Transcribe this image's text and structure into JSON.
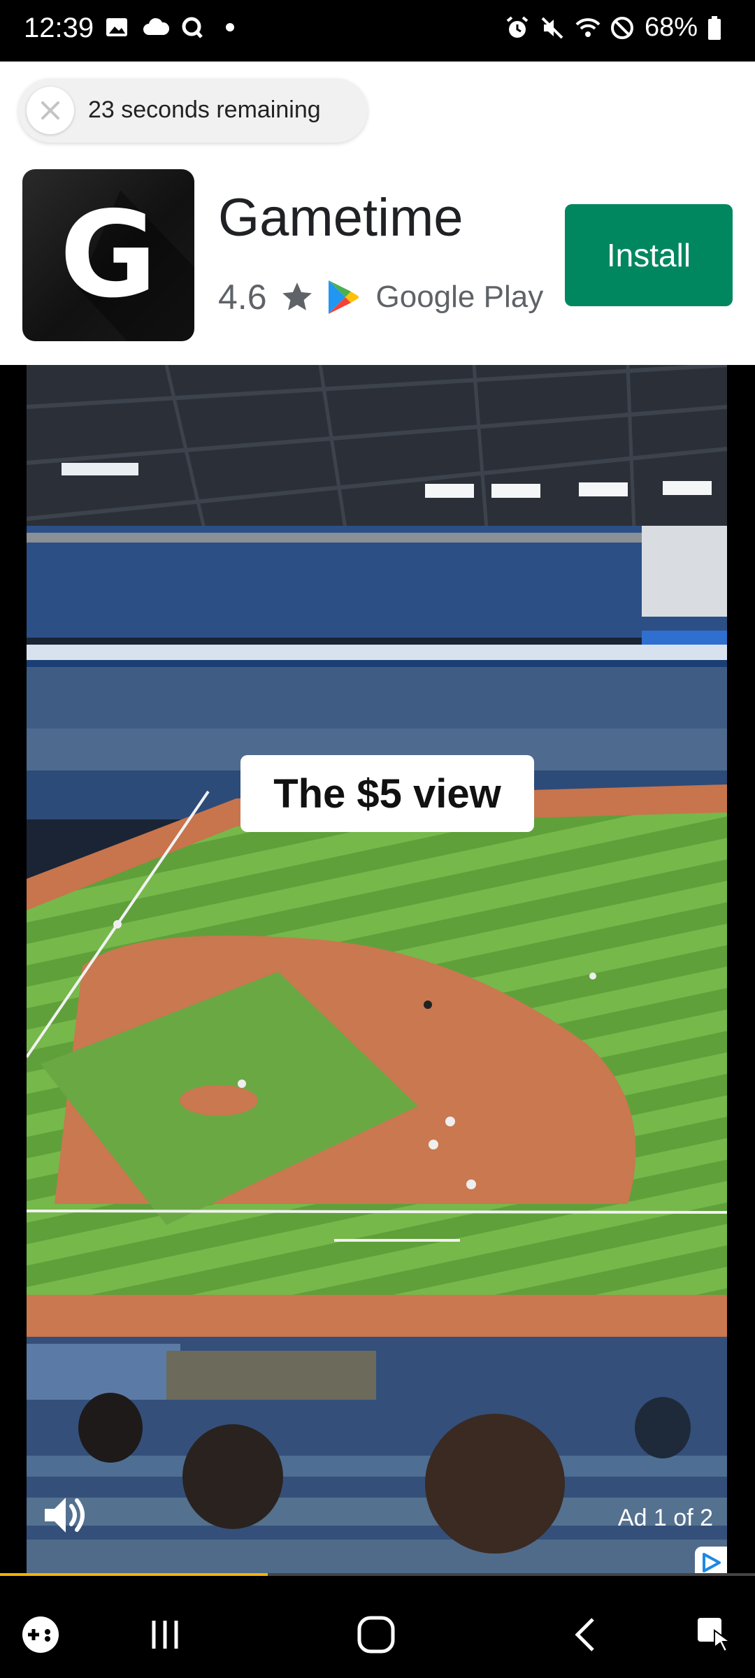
{
  "status_bar": {
    "time": "12:39",
    "battery": "68%",
    "icons_left": [
      "gallery-icon",
      "cloud-icon",
      "q-app-icon",
      "dot-icon"
    ],
    "icons_right": [
      "alarm-icon",
      "mute-icon",
      "wifi-icon",
      "dnd-icon",
      "battery-icon"
    ]
  },
  "ad": {
    "timer_text": "23 seconds remaining",
    "app_icon_letter": "G",
    "app_name": "Gametime",
    "rating": "4.6",
    "store_label": "Google Play",
    "install_label": "Install",
    "caption": "The $5 view",
    "ad_counter": "Ad 1 of 2",
    "progress_fraction": 0.355
  },
  "colors": {
    "install_bg": "#01875f",
    "progress": "#f2b400"
  },
  "nav_bar": {
    "buttons": [
      "game-launcher-icon",
      "recents-icon",
      "home-icon",
      "back-icon",
      "accessibility-icon"
    ]
  }
}
